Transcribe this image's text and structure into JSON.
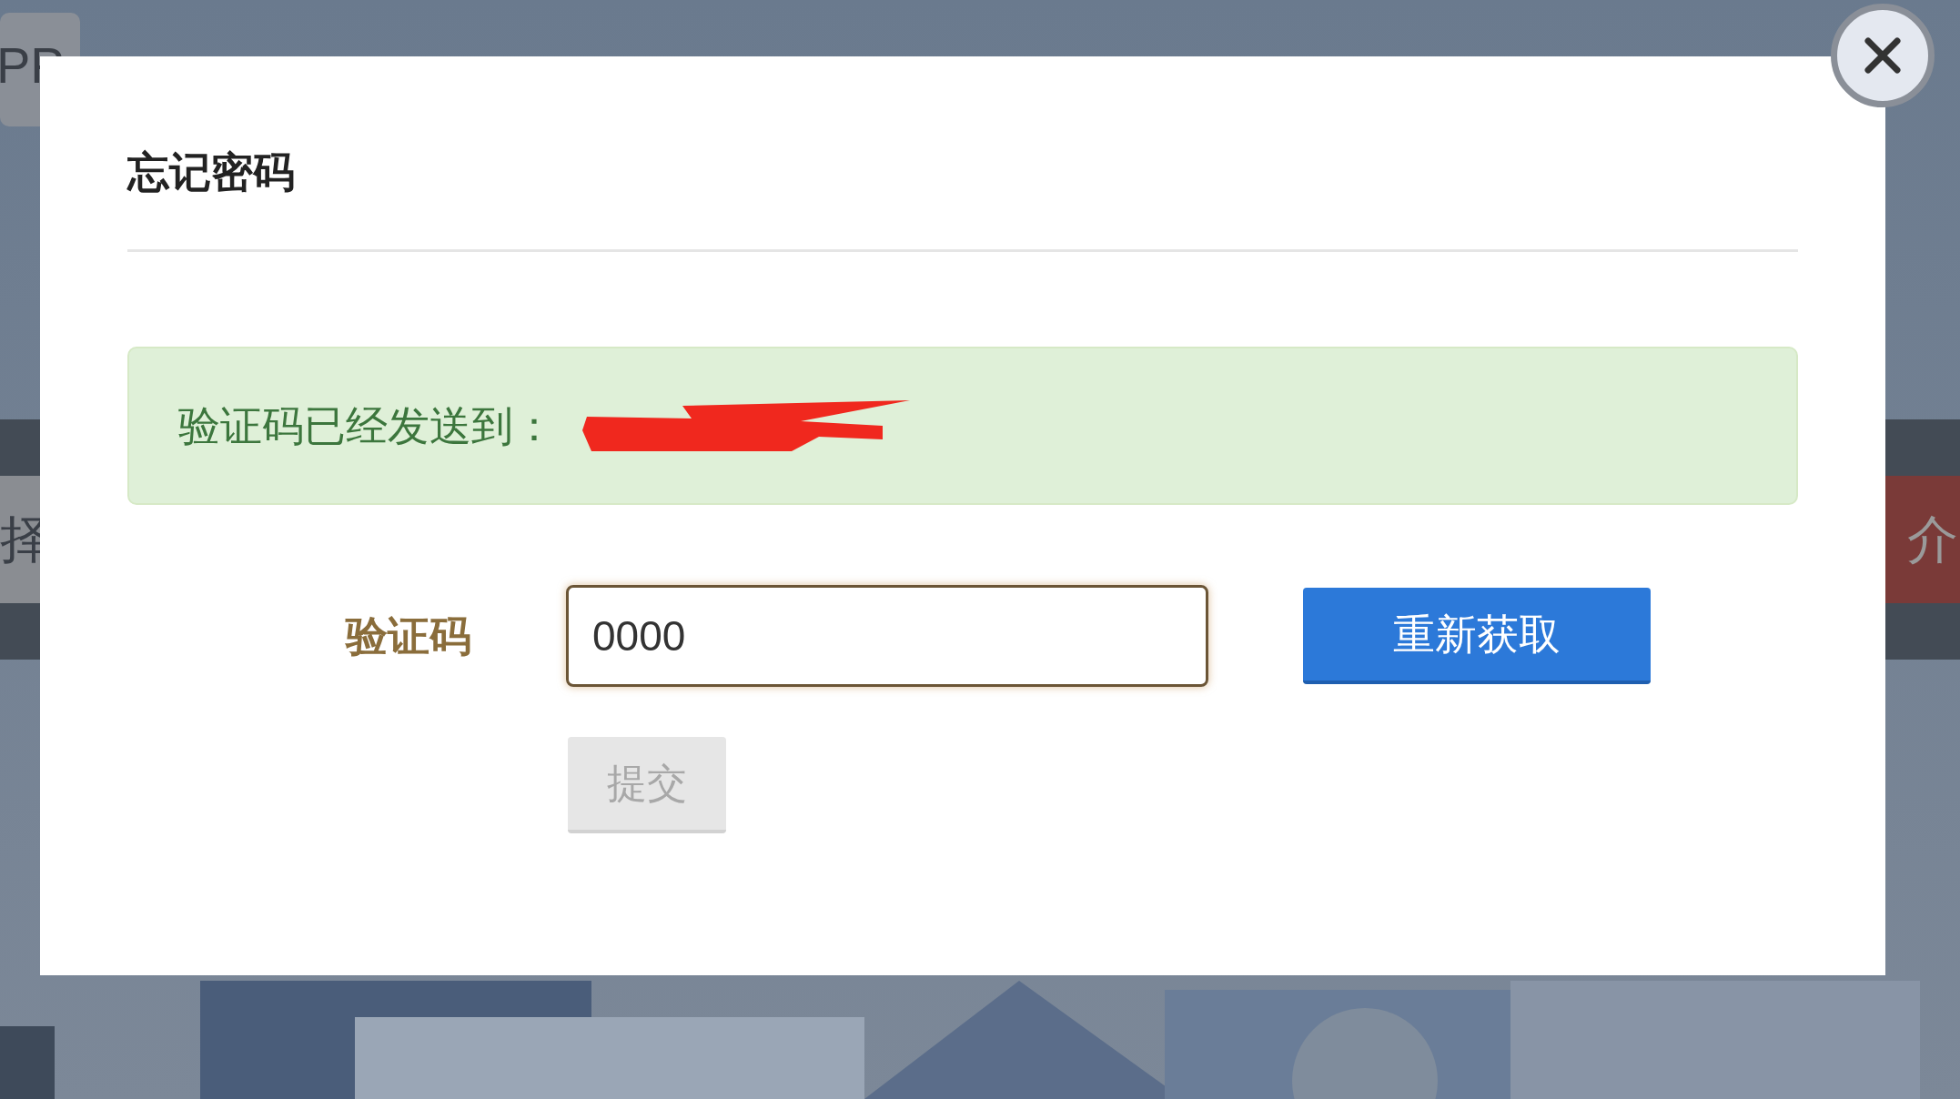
{
  "background": {
    "tab_label": "PP",
    "left_label": "择",
    "right_label": "介"
  },
  "dialog": {
    "title": "忘记密码",
    "alert": {
      "text": "验证码已经发送到：",
      "redacted": true
    },
    "code_field": {
      "label": "验证码",
      "value": "0000"
    },
    "resend_button": "重新获取",
    "submit_button": {
      "label": "提交",
      "disabled": true
    }
  }
}
